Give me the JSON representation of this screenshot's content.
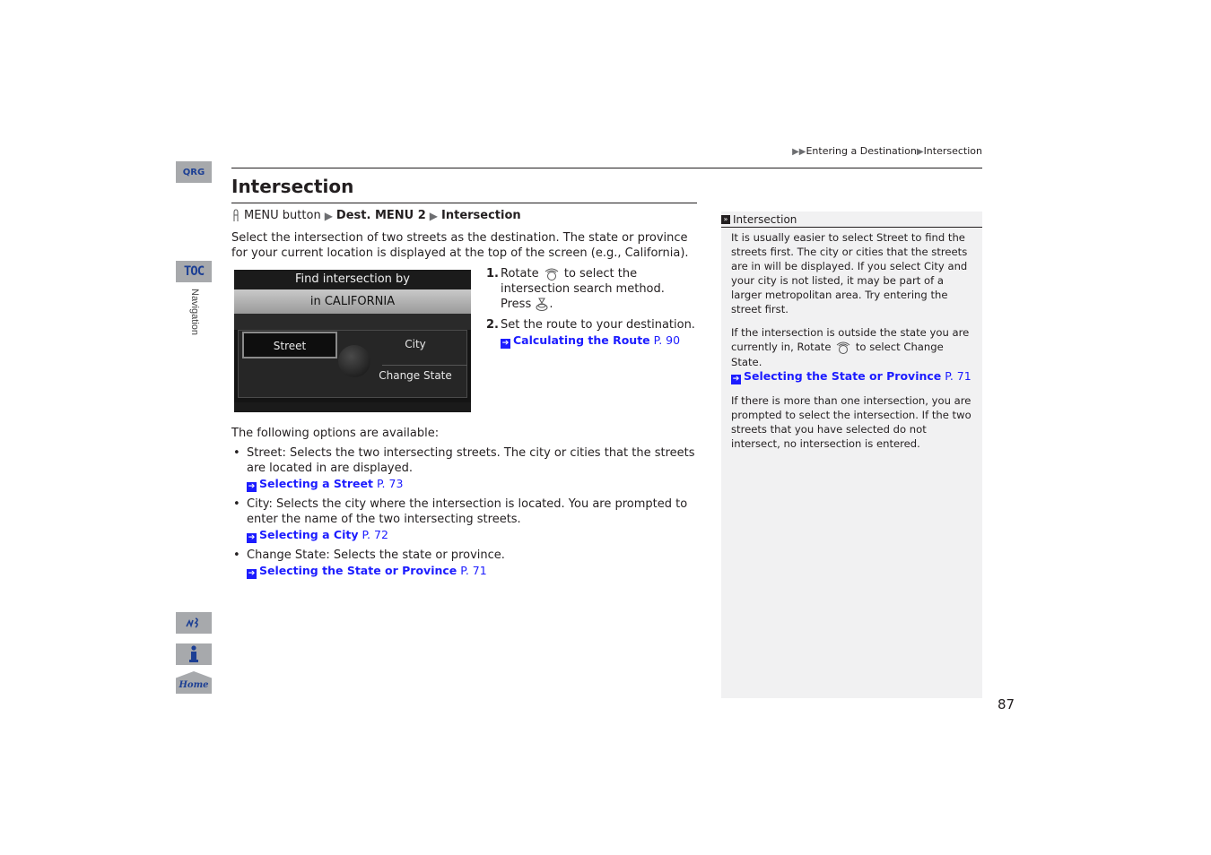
{
  "side_nav": {
    "qrg_label": "QRG",
    "toc_label": "TOC",
    "section_label": "Navigation",
    "home_label": "Home"
  },
  "breadcrumb": [
    "Entering a Destination",
    "Intersection"
  ],
  "page_title": "Intersection",
  "menu_path": {
    "start": "MENU button",
    "step1": "Dest. MENU 2",
    "step2": "Intersection"
  },
  "intro": "Select the intersection of two streets as the destination. The state or province for your current location is displayed at the top of the screen (e.g., California).",
  "screen": {
    "header": "Find intersection by",
    "state": "in CALIFORNIA",
    "options": [
      "Street",
      "City",
      "Change State"
    ],
    "selected": "Street"
  },
  "steps": [
    {
      "num": "1.",
      "pre": "Rotate",
      "post": "to select the intersection search method.",
      "press_label": "Press",
      "press_end": "."
    },
    {
      "num": "2.",
      "text": "Set the route to your destination.",
      "ref_title": "Calculating the Route",
      "ref_page": "P. 90"
    }
  ],
  "options_intro": "The following options are available:",
  "options": [
    {
      "term": "Street",
      "desc": ": Selects the two intersecting streets. The city or cities that the streets are located in are displayed.",
      "ref_title": "Selecting a Street",
      "ref_page": "P. 73"
    },
    {
      "term": "City",
      "desc": ": Selects the city where the intersection is located. You are prompted to enter the name of the two intersecting streets.",
      "ref_title": "Selecting a City",
      "ref_page": "P. 72"
    },
    {
      "term": "Change State",
      "desc": ": Selects the state or province.",
      "ref_title": "Selecting the State or Province",
      "ref_page": "P. 71"
    }
  ],
  "sidebar": {
    "title": "Intersection",
    "p1_a": "It is usually easier to select ",
    "p1_b": "Street",
    "p1_c": " to find the streets first. The city or cities that the streets are in will be displayed. If you select ",
    "p1_d": "City",
    "p1_e": " and your city is not listed, it may be part of a larger metropolitan area. Try entering the street first.",
    "p2_a": "If the intersection is outside the state you are currently in, Rotate ",
    "p2_b": " to select ",
    "p2_c": "Change State",
    "p2_d": ".",
    "p2_ref_title": "Selecting the State or Province",
    "p2_ref_page": "P. 71",
    "p3": "If there is more than one intersection, you are prompted to select the intersection. If the two streets that you have selected do not intersect, no intersection is entered."
  },
  "page_number": "87"
}
